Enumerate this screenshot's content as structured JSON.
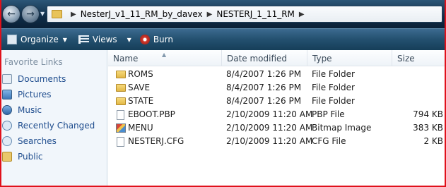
{
  "address": {
    "crumbs": [
      "NesterJ_v1_11_RM_by_davex",
      "NESTERJ_1_11_RM"
    ]
  },
  "toolbar": {
    "organize_label": "Organize",
    "views_label": "Views",
    "burn_label": "Burn"
  },
  "sidebar": {
    "header": "Favorite Links",
    "items": [
      {
        "label": "Documents",
        "icon": "documents-icon"
      },
      {
        "label": "Pictures",
        "icon": "pictures-icon"
      },
      {
        "label": "Music",
        "icon": "music-icon"
      },
      {
        "label": "Recently Changed",
        "icon": "recently-changed-icon"
      },
      {
        "label": "Searches",
        "icon": "searches-icon"
      },
      {
        "label": "Public",
        "icon": "public-folder-icon"
      }
    ]
  },
  "columns": {
    "name": "Name",
    "date": "Date modified",
    "type": "Type",
    "size": "Size"
  },
  "files": [
    {
      "name": "ROMS",
      "date": "8/4/2007 1:26 PM",
      "type": "File Folder",
      "size": "",
      "icon": "folder-icon"
    },
    {
      "name": "SAVE",
      "date": "8/4/2007 1:26 PM",
      "type": "File Folder",
      "size": "",
      "icon": "folder-icon"
    },
    {
      "name": "STATE",
      "date": "8/4/2007 1:26 PM",
      "type": "File Folder",
      "size": "",
      "icon": "folder-icon"
    },
    {
      "name": "EBOOT.PBP",
      "date": "2/10/2009 11:20 AM",
      "type": "PBP File",
      "size": "794 KB",
      "icon": "file-icon"
    },
    {
      "name": "MENU",
      "date": "2/10/2009 11:20 AM",
      "type": "Bitmap Image",
      "size": "383 KB",
      "icon": "bitmap-icon"
    },
    {
      "name": "NESTERJ.CFG",
      "date": "2/10/2009 11:20 AM",
      "type": "CFG File",
      "size": "2 KB",
      "icon": "file-icon"
    }
  ]
}
